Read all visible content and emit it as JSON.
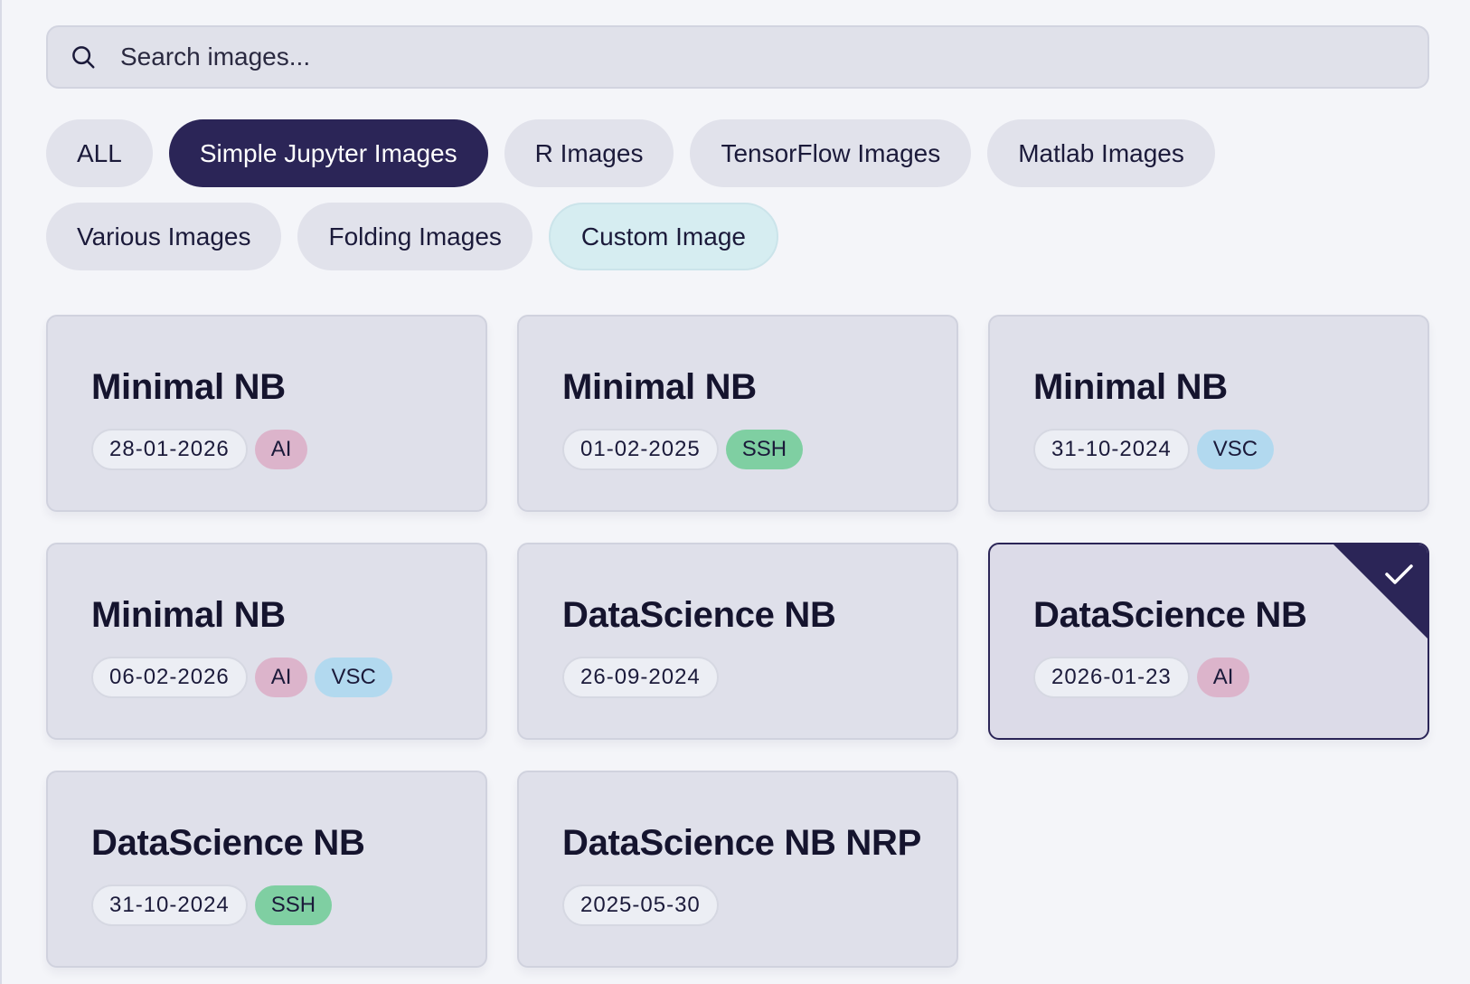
{
  "search": {
    "placeholder": "Search images...",
    "value": ""
  },
  "filters": {
    "row1": [
      {
        "label": "ALL",
        "state": "default"
      },
      {
        "label": "Simple Jupyter Images",
        "state": "active"
      },
      {
        "label": "R Images",
        "state": "default"
      },
      {
        "label": "TensorFlow Images",
        "state": "default"
      },
      {
        "label": "Matlab Images",
        "state": "default"
      }
    ],
    "row2": [
      {
        "label": "Various Images",
        "state": "default"
      },
      {
        "label": "Folding Images",
        "state": "default"
      },
      {
        "label": "Custom Image",
        "state": "custom"
      }
    ]
  },
  "cards": [
    {
      "title": "Minimal NB",
      "date": "28-01-2026",
      "tags": [
        "AI"
      ]
    },
    {
      "title": "Minimal NB",
      "date": "01-02-2025",
      "tags": [
        "SSH"
      ]
    },
    {
      "title": "Minimal NB",
      "date": "31-10-2024",
      "tags": [
        "VSC"
      ]
    },
    {
      "title": "Minimal NB",
      "date": "06-02-2026",
      "tags": [
        "AI",
        "VSC"
      ]
    },
    {
      "title": "DataScience NB",
      "date": "26-09-2024",
      "tags": []
    },
    {
      "title": "DataScience NB",
      "date": "2026-01-23",
      "tags": [
        "AI"
      ],
      "selected": true
    },
    {
      "title": "DataScience NB",
      "date": "31-10-2024",
      "tags": [
        "SSH"
      ]
    },
    {
      "title": "DataScience NB NRP",
      "date": "2025-05-30",
      "tags": []
    }
  ],
  "icons": {
    "search": "search-icon",
    "selected": "check-icon"
  },
  "colors": {
    "accent": "#2b2557",
    "ai": "#dcb4cb",
    "ssh": "#7fcfa2",
    "vsc": "#b2d9ef",
    "custom": "#d6edf1"
  }
}
